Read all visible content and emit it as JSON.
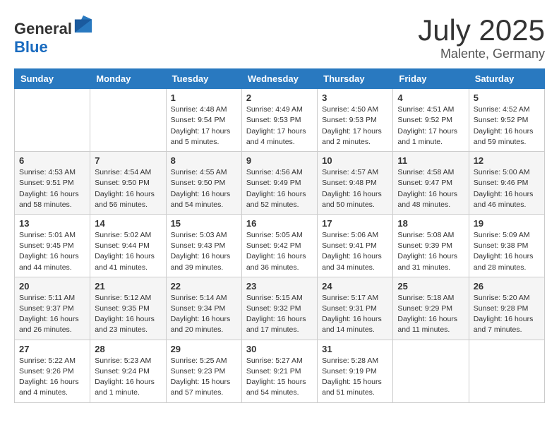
{
  "header": {
    "logo_general": "General",
    "logo_blue": "Blue",
    "month": "July 2025",
    "location": "Malente, Germany"
  },
  "weekdays": [
    "Sunday",
    "Monday",
    "Tuesday",
    "Wednesday",
    "Thursday",
    "Friday",
    "Saturday"
  ],
  "weeks": [
    [
      {
        "day": "",
        "info": ""
      },
      {
        "day": "",
        "info": ""
      },
      {
        "day": "1",
        "info": "Sunrise: 4:48 AM\nSunset: 9:54 PM\nDaylight: 17 hours\nand 5 minutes."
      },
      {
        "day": "2",
        "info": "Sunrise: 4:49 AM\nSunset: 9:53 PM\nDaylight: 17 hours\nand 4 minutes."
      },
      {
        "day": "3",
        "info": "Sunrise: 4:50 AM\nSunset: 9:53 PM\nDaylight: 17 hours\nand 2 minutes."
      },
      {
        "day": "4",
        "info": "Sunrise: 4:51 AM\nSunset: 9:52 PM\nDaylight: 17 hours\nand 1 minute."
      },
      {
        "day": "5",
        "info": "Sunrise: 4:52 AM\nSunset: 9:52 PM\nDaylight: 16 hours\nand 59 minutes."
      }
    ],
    [
      {
        "day": "6",
        "info": "Sunrise: 4:53 AM\nSunset: 9:51 PM\nDaylight: 16 hours\nand 58 minutes."
      },
      {
        "day": "7",
        "info": "Sunrise: 4:54 AM\nSunset: 9:50 PM\nDaylight: 16 hours\nand 56 minutes."
      },
      {
        "day": "8",
        "info": "Sunrise: 4:55 AM\nSunset: 9:50 PM\nDaylight: 16 hours\nand 54 minutes."
      },
      {
        "day": "9",
        "info": "Sunrise: 4:56 AM\nSunset: 9:49 PM\nDaylight: 16 hours\nand 52 minutes."
      },
      {
        "day": "10",
        "info": "Sunrise: 4:57 AM\nSunset: 9:48 PM\nDaylight: 16 hours\nand 50 minutes."
      },
      {
        "day": "11",
        "info": "Sunrise: 4:58 AM\nSunset: 9:47 PM\nDaylight: 16 hours\nand 48 minutes."
      },
      {
        "day": "12",
        "info": "Sunrise: 5:00 AM\nSunset: 9:46 PM\nDaylight: 16 hours\nand 46 minutes."
      }
    ],
    [
      {
        "day": "13",
        "info": "Sunrise: 5:01 AM\nSunset: 9:45 PM\nDaylight: 16 hours\nand 44 minutes."
      },
      {
        "day": "14",
        "info": "Sunrise: 5:02 AM\nSunset: 9:44 PM\nDaylight: 16 hours\nand 41 minutes."
      },
      {
        "day": "15",
        "info": "Sunrise: 5:03 AM\nSunset: 9:43 PM\nDaylight: 16 hours\nand 39 minutes."
      },
      {
        "day": "16",
        "info": "Sunrise: 5:05 AM\nSunset: 9:42 PM\nDaylight: 16 hours\nand 36 minutes."
      },
      {
        "day": "17",
        "info": "Sunrise: 5:06 AM\nSunset: 9:41 PM\nDaylight: 16 hours\nand 34 minutes."
      },
      {
        "day": "18",
        "info": "Sunrise: 5:08 AM\nSunset: 9:39 PM\nDaylight: 16 hours\nand 31 minutes."
      },
      {
        "day": "19",
        "info": "Sunrise: 5:09 AM\nSunset: 9:38 PM\nDaylight: 16 hours\nand 28 minutes."
      }
    ],
    [
      {
        "day": "20",
        "info": "Sunrise: 5:11 AM\nSunset: 9:37 PM\nDaylight: 16 hours\nand 26 minutes."
      },
      {
        "day": "21",
        "info": "Sunrise: 5:12 AM\nSunset: 9:35 PM\nDaylight: 16 hours\nand 23 minutes."
      },
      {
        "day": "22",
        "info": "Sunrise: 5:14 AM\nSunset: 9:34 PM\nDaylight: 16 hours\nand 20 minutes."
      },
      {
        "day": "23",
        "info": "Sunrise: 5:15 AM\nSunset: 9:32 PM\nDaylight: 16 hours\nand 17 minutes."
      },
      {
        "day": "24",
        "info": "Sunrise: 5:17 AM\nSunset: 9:31 PM\nDaylight: 16 hours\nand 14 minutes."
      },
      {
        "day": "25",
        "info": "Sunrise: 5:18 AM\nSunset: 9:29 PM\nDaylight: 16 hours\nand 11 minutes."
      },
      {
        "day": "26",
        "info": "Sunrise: 5:20 AM\nSunset: 9:28 PM\nDaylight: 16 hours\nand 7 minutes."
      }
    ],
    [
      {
        "day": "27",
        "info": "Sunrise: 5:22 AM\nSunset: 9:26 PM\nDaylight: 16 hours\nand 4 minutes."
      },
      {
        "day": "28",
        "info": "Sunrise: 5:23 AM\nSunset: 9:24 PM\nDaylight: 16 hours\nand 1 minute."
      },
      {
        "day": "29",
        "info": "Sunrise: 5:25 AM\nSunset: 9:23 PM\nDaylight: 15 hours\nand 57 minutes."
      },
      {
        "day": "30",
        "info": "Sunrise: 5:27 AM\nSunset: 9:21 PM\nDaylight: 15 hours\nand 54 minutes."
      },
      {
        "day": "31",
        "info": "Sunrise: 5:28 AM\nSunset: 9:19 PM\nDaylight: 15 hours\nand 51 minutes."
      },
      {
        "day": "",
        "info": ""
      },
      {
        "day": "",
        "info": ""
      }
    ]
  ]
}
